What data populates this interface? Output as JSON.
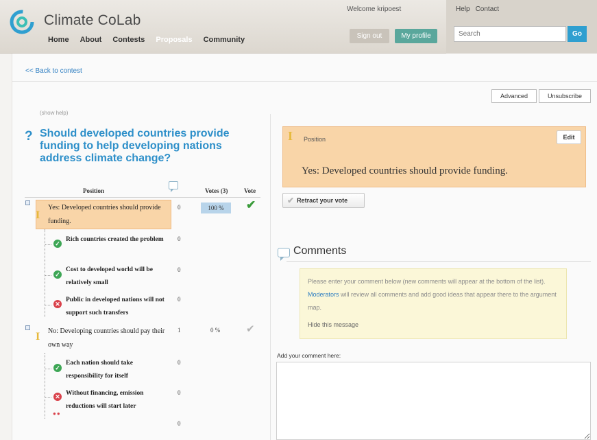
{
  "header": {
    "brand": "Climate CoLab",
    "nav": [
      "Home",
      "About",
      "Contests",
      "Proposals",
      "Community"
    ],
    "welcome": "Welcome kripoest",
    "sign_out": "Sign out",
    "my_profile": "My profile",
    "help": "Help",
    "contact": "Contact",
    "search_placeholder": "Search",
    "search_button": "Go"
  },
  "back_link": "<< Back to contest",
  "actions": {
    "advanced": "Advanced",
    "unsubscribe": "Unsubscribe"
  },
  "show_help": "(show help)",
  "question": {
    "mark": "?",
    "text": "Should developed countries provide funding to help developing nations address climate change?"
  },
  "table": {
    "header_position": "Position",
    "header_votes": "Votes (3)",
    "header_vote": "Vote",
    "positions": [
      {
        "text": "Yes: Developed countries should provide funding.",
        "comments": "0",
        "votes": "100 %",
        "vote_fraction": 1.0,
        "voted": true,
        "arguments": [
          {
            "type": "pro",
            "text": "Rich countries created the problem",
            "comments": "0"
          },
          {
            "type": "pro",
            "text": "Cost to developed world will be relatively small",
            "comments": "0"
          },
          {
            "type": "con",
            "text": "Public in developed nations will not support such transfers",
            "comments": "0"
          }
        ]
      },
      {
        "text": "No: Developing countries should pay their own way",
        "comments": "1",
        "votes": "0 %",
        "vote_fraction": 0.0,
        "voted": false,
        "arguments": [
          {
            "type": "pro",
            "text": "Each nation should take responsibility for itself",
            "comments": "0"
          },
          {
            "type": "con",
            "text": "Without financing, emission reductions will start later",
            "comments": "0"
          }
        ],
        "extra_comments": "0"
      }
    ]
  },
  "position_card": {
    "label": "Position",
    "edit": "Edit",
    "text": "Yes: Developed countries should provide funding."
  },
  "retract": "Retract your vote",
  "comments": {
    "title": "Comments",
    "notice_before": "Please enter your comment below (new comments will appear at the bottom of the list). ",
    "notice_link": "Moderators",
    "notice_after": " will review all comments and add good ideas that appear there to the argument map.",
    "hide": "Hide this message",
    "add_label": "Add your comment here:"
  },
  "colors": {
    "accent_blue": "#2d8fc9",
    "position_highlight": "#f9d5a8",
    "notice_bg": "#fbf7d8",
    "pro_green": "#3da655",
    "con_red": "#d9414a"
  },
  "icons": [
    "colab-logo",
    "comment-icon",
    "pro-icon",
    "con-icon",
    "position-icon",
    "check-icon",
    "toggle-icon"
  ]
}
